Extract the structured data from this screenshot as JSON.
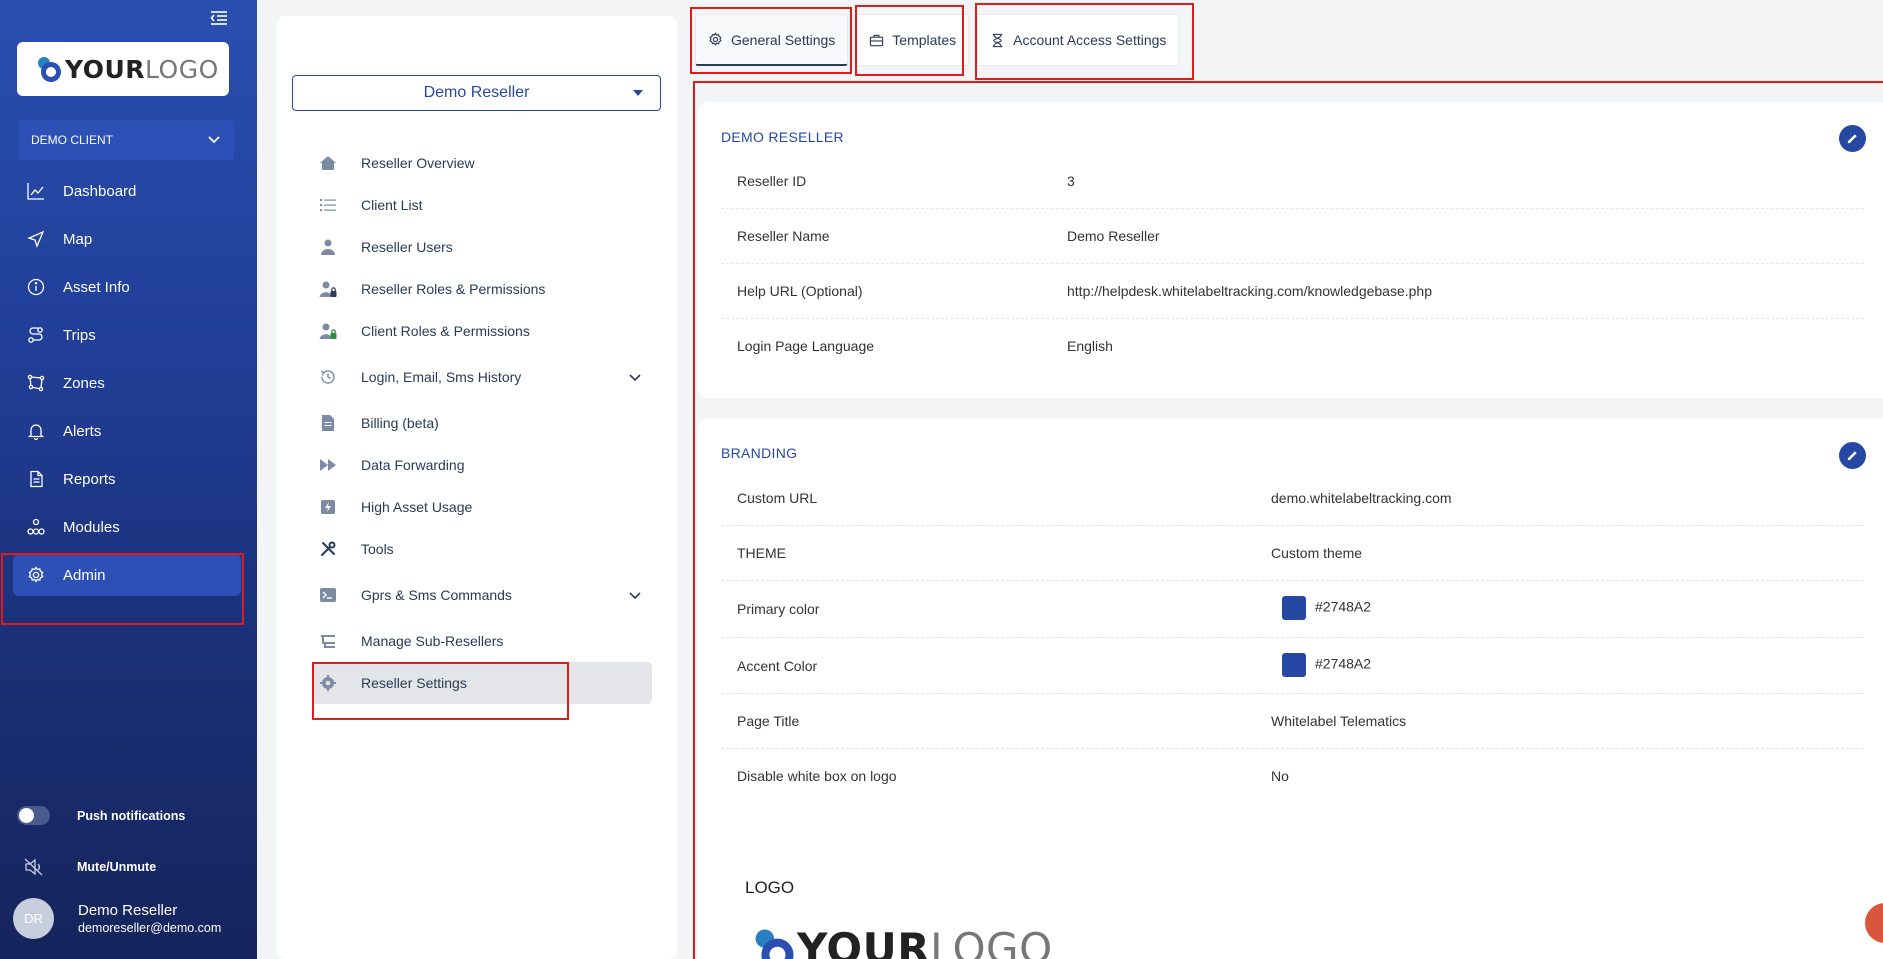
{
  "sidebar": {
    "logo": {
      "bold": "YOUR",
      "light": "LOGO"
    },
    "client_select": "DEMO CLIENT",
    "nav": [
      {
        "label": "Dashboard",
        "icon": "chart-line-icon"
      },
      {
        "label": "Map",
        "icon": "navigation-arrow-icon"
      },
      {
        "label": "Asset Info",
        "icon": "info-icon"
      },
      {
        "label": "Trips",
        "icon": "route-icon"
      },
      {
        "label": "Zones",
        "icon": "zones-icon"
      },
      {
        "label": "Alerts",
        "icon": "bell-icon"
      },
      {
        "label": "Reports",
        "icon": "document-icon"
      },
      {
        "label": "Modules",
        "icon": "modules-icon"
      },
      {
        "label": "Admin",
        "icon": "gear-icon",
        "active": true
      }
    ],
    "push_notifications": "Push notifications",
    "mute": "Mute/Unmute",
    "user": {
      "initials": "DR",
      "name": "Demo Reseller",
      "email": "demoreseller@demo.com"
    }
  },
  "middle": {
    "reseller_select": "Demo Reseller",
    "menu": [
      {
        "label": "Reseller Overview",
        "icon": "home-icon"
      },
      {
        "label": "Client List",
        "icon": "list-icon"
      },
      {
        "label": "Reseller Users",
        "icon": "user-icon"
      },
      {
        "label": "Reseller Roles & Permissions",
        "icon": "user-lock-icon"
      },
      {
        "label": "Client Roles & Permissions",
        "icon": "user-lock-green-icon"
      },
      {
        "label": "Login, Email, Sms History",
        "icon": "history-icon",
        "expandable": true
      },
      {
        "label": "Billing (beta)",
        "icon": "file-icon"
      },
      {
        "label": "Data Forwarding",
        "icon": "forward-icon"
      },
      {
        "label": "High Asset Usage",
        "icon": "bolt-icon"
      },
      {
        "label": "Tools",
        "icon": "tools-icon"
      },
      {
        "label": "Gprs & Sms Commands",
        "icon": "terminal-icon",
        "expandable": true
      },
      {
        "label": "Manage Sub-Resellers",
        "icon": "subresellers-icon"
      },
      {
        "label": "Reseller Settings",
        "icon": "settings-icon",
        "active": true
      }
    ]
  },
  "tabs": [
    {
      "label": "General Settings",
      "icon": "gear-icon",
      "active": true
    },
    {
      "label": "Templates",
      "icon": "briefcase-icon"
    },
    {
      "label": "Account Access Settings",
      "icon": "hourglass-icon"
    }
  ],
  "demo_reseller": {
    "title": "DEMO RESELLER",
    "rows": [
      {
        "label": "Reseller ID",
        "value": "3"
      },
      {
        "label": "Reseller Name",
        "value": "Demo Reseller"
      },
      {
        "label": "Help URL (Optional)",
        "value": "http://helpdesk.whitelabeltracking.com/knowledgebase.php"
      },
      {
        "label": "Login Page Language",
        "value": "English"
      }
    ]
  },
  "branding": {
    "title": "BRANDING",
    "rows": [
      {
        "label": "Custom URL",
        "value": "demo.whitelabeltracking.com"
      },
      {
        "label": "THEME",
        "value": "Custom theme"
      },
      {
        "label": "Primary color",
        "value": "#2748A2",
        "swatch": "#2748A2"
      },
      {
        "label": "Accent Color",
        "value": "#2748A2",
        "swatch": "#2748A2"
      },
      {
        "label": "Page Title",
        "value": "Whitelabel Telematics"
      },
      {
        "label": "Disable white box on logo",
        "value": "No"
      }
    ],
    "logo_heading": "LOGO"
  },
  "colors": {
    "primary": "#2748A2",
    "highlight": "#E01B1B",
    "fab": "#D9563C"
  }
}
